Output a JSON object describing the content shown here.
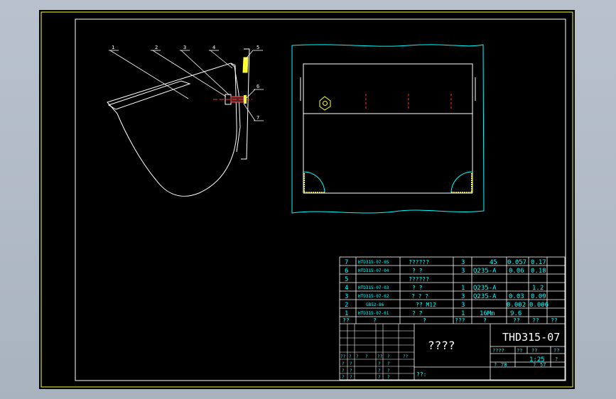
{
  "drawing": {
    "part_number": "THD315-07",
    "drawing_title_placeholder": "????",
    "scale": "1:25",
    "sheet_total": "?",
    "sheet_counts": [
      "78",
      "57"
    ],
    "footer_note": "??:"
  },
  "balloons": [
    "1",
    "2",
    "3",
    "4",
    "5",
    "6",
    "7"
  ],
  "bom": {
    "rows": [
      {
        "no": "7",
        "code": "HTD315-07-05",
        "name": "??????",
        "qty": "3",
        "material": "45",
        "unit_wt": "0.057",
        "total_wt": "0.17"
      },
      {
        "no": "6",
        "code": "HTD315-07-04",
        "name": "?      ?",
        "qty": "3",
        "material": "Q235-A",
        "unit_wt": "0.06",
        "total_wt": "0.18"
      },
      {
        "no": "5",
        "code": "",
        "name": "??????",
        "qty": "",
        "material": "",
        "unit_wt": "",
        "total_wt": ""
      },
      {
        "no": "4",
        "code": "HTD315-07-03",
        "name": "?      ?",
        "qty": "1",
        "material": "Q235-A",
        "unit_wt": "",
        "total_wt": "1.2"
      },
      {
        "no": "3",
        "code": "HTD315-07-02",
        "name": "?  ?  ?",
        "qty": "3",
        "material": "Q235-A",
        "unit_wt": "0.03",
        "total_wt": "0.09"
      },
      {
        "no": "2",
        "code": "GB52-86",
        "name": "??    M12",
        "qty": "3",
        "material": "",
        "unit_wt": "0.002",
        "total_wt": "0.006"
      },
      {
        "no": "1",
        "code": "HTD315-07-01",
        "name": "?      ?",
        "qty": "1",
        "material": "16Mn",
        "unit_wt": "9.6",
        "total_wt": ""
      }
    ],
    "header": {
      "no": "??",
      "code": "?",
      "name": "?",
      "qty": "???",
      "material": "?",
      "unit_wt": "??",
      "total_wt": "??",
      "note": "??"
    }
  },
  "left_block": {
    "sign_row": [
      "??",
      "?",
      "?",
      "?",
      "??",
      "?",
      "??"
    ],
    "rows": [
      [
        "?",
        "?",
        "?",
        "?"
      ],
      [
        "?",
        "?",
        "?",
        "?"
      ],
      [
        "?",
        "?",
        "?",
        "?"
      ],
      [
        "?",
        "?",
        "?",
        "?"
      ]
    ]
  },
  "right_block": {
    "labels": [
      "????",
      "??",
      "??",
      "??",
      "?",
      "?"
    ]
  }
}
